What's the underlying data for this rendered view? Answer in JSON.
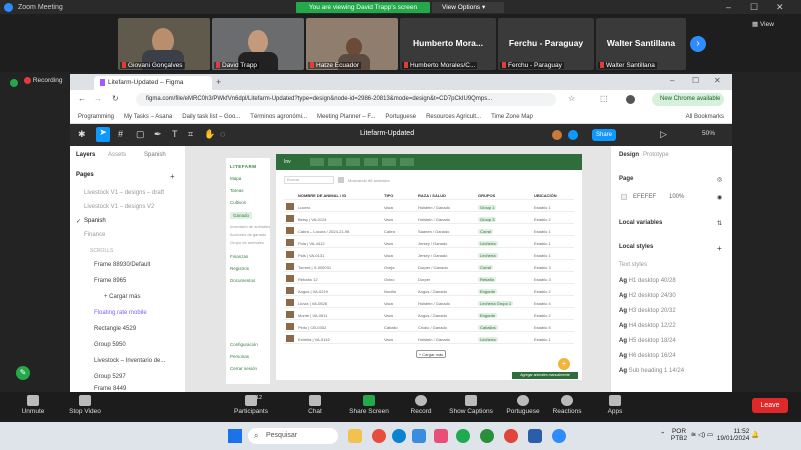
{
  "zoom": {
    "title": "Zoom Meeting",
    "banner": "You are viewing David Trapp's screen",
    "view_options": "View Options",
    "view": "View"
  },
  "gallery": {
    "participants": [
      {
        "name": "Giovani Gonçalves"
      },
      {
        "name": "David Trapp"
      },
      {
        "name": "Hatze Ecuador"
      }
    ],
    "name_tiles": [
      {
        "big": "Humberto Mora...",
        "label": "Humberto Morales/C..."
      },
      {
        "big": "Ferchu - Paraguay",
        "label": "Ferchu - Paraguay"
      },
      {
        "big": "Walter Santillana",
        "label": "Walter Santillana"
      }
    ]
  },
  "recording": "Recording",
  "chrome": {
    "tab_title": "Litefarm-Updated – Figma",
    "url": "figma.com/file/eMRC0h3/PWkfVn6dpl/Litefarm-Updated?type=design&node-id=2986-20813&mode=design&t=CD7pCkIU9Qmps...",
    "new_chrome": "New Chrome available",
    "bookmarks": [
      "Programming",
      "My Tasks – Asana",
      "Daily task list – Goo...",
      "Términos agronómi...",
      "Meeting Planner – F...",
      "Portuguese",
      "Resources Agricult...",
      "Time Zone Map",
      "All Bookmarks"
    ]
  },
  "figma": {
    "file_title": "Litefarm-Updated",
    "share": "Share",
    "zoom": "50%",
    "left": {
      "tabs": [
        "Layers",
        "Assets"
      ],
      "page_select": "Spanish",
      "pages_header": "Pages",
      "pages": [
        "Livestock V1 – designs – draft",
        "Livestock V1 – designs V2",
        "Spanish",
        "Finance"
      ],
      "layers_header": "SCROLLS",
      "layers": [
        "Frame 88930/Default",
        "Frame 8965",
        "+ Cargar más",
        "Floating rate mobile",
        "Rectangle 4529",
        "Group 5950",
        "Livestock – Inventario de...",
        "Group 5297",
        "Frame 8449"
      ]
    },
    "right": {
      "tabs": [
        "Design",
        "Prototype"
      ],
      "page_label": "Page",
      "page_color": "EFEFEF",
      "page_opacity": "100%",
      "local_variables": "Local variables",
      "local_styles": "Local styles",
      "text_styles": "Text styles",
      "styles": [
        "H1 desktop 40/28",
        "H2 desktop 24/30",
        "H3 desktop 20/32",
        "H4 desktop 12/22",
        "H5 desktop 18/24",
        "H6 desktop 16/24",
        "Sub heading 1 14/24"
      ]
    },
    "canvas": {
      "side_items": [
        "Mapa",
        "Tareas",
        "Cultivos",
        "Ganado",
        "Inventario de animales",
        "Acciones de ganado",
        "Grupo de animales",
        "Finanzas",
        "Registros",
        "Documentos",
        "Configuración",
        "Personas",
        "Cerrar sesión"
      ],
      "tab_label": "Inv",
      "search_placeholder": "Buscar",
      "filter_text": "Mostrando 88 animales",
      "columns": [
        "NOMBRE DE ANIMAL / ID",
        "TIPO",
        "RAZA / SALUD",
        "GRUPOS",
        "UBICACIÓN"
      ],
      "rows": [
        [
          "Lucero",
          "Vaca",
          "Holstein / Ganado",
          "Group 1",
          "Establo 1"
        ],
        [
          "Betsy | VA-0124",
          "Vaca",
          "Holstein / Ganado",
          "Group 3",
          "Establo 2"
        ],
        [
          "Cabra – Locura / 2024-21-98",
          "Cabra",
          "Saanen / Ganado",
          "Corral",
          "Establo 1"
        ],
        [
          "Pola | VA-4412",
          "Vaca",
          "Jersey / Ganado",
          "Lechería",
          "Establo 1"
        ],
        [
          "Pais | VA-0131",
          "Vaca",
          "Jersey / Ganado",
          "Lechería",
          "Establo 1"
        ],
        [
          "Torrent | S-000031",
          "Oveja",
          "Dorper / Ganado",
          "Corral",
          "Establo 3"
        ],
        [
          "Rebaño 12",
          "Ovino",
          "Dorper",
          "Rebaño",
          "Establo 3"
        ],
        [
          "Angus | VA-0219",
          "Novillo",
          "Angus / Ganado",
          "Engorde",
          "Establo 2"
        ],
        [
          "Lluvia | VA-0528",
          "Vaca",
          "Holstein / Ganado",
          "Lechería Grupo 1",
          "Establo 4"
        ],
        [
          "Monte | VA-0611",
          "Vaca",
          "Angus / Ganado",
          "Engorde",
          "Establo 2"
        ],
        [
          "Pinto | CB-0302",
          "Caballo",
          "Criollo / Ganado",
          "Caballos",
          "Establo 5"
        ],
        [
          "Estrella | VA-0142",
          "Vaca",
          "Holstein / Ganado",
          "Lechería",
          "Establo 1"
        ]
      ],
      "load_more": "+ Cargar más",
      "toast": "Agregar animales manualmente"
    }
  },
  "controls": [
    {
      "label": "Unmute"
    },
    {
      "label": "Stop Video"
    },
    {
      "label": "Participants",
      "count": "12"
    },
    {
      "label": "Chat"
    },
    {
      "label": "Share Screen"
    },
    {
      "label": "Record"
    },
    {
      "label": "Show Captions"
    },
    {
      "label": "Portuguese"
    },
    {
      "label": "Reactions"
    },
    {
      "label": "Apps"
    }
  ],
  "leave": "Leave",
  "taskbar": {
    "search": "Pesquisar",
    "lang": "POR",
    "layout": "PTB2",
    "time": "11:52",
    "date": "19/01/2024"
  },
  "colors": {
    "zoom_green": "#23a94a",
    "zoom_blue": "#2d8cff",
    "figma_blue": "#0d99ff",
    "litefarm_green": "#2f6e3c",
    "leave_red": "#e02828"
  }
}
